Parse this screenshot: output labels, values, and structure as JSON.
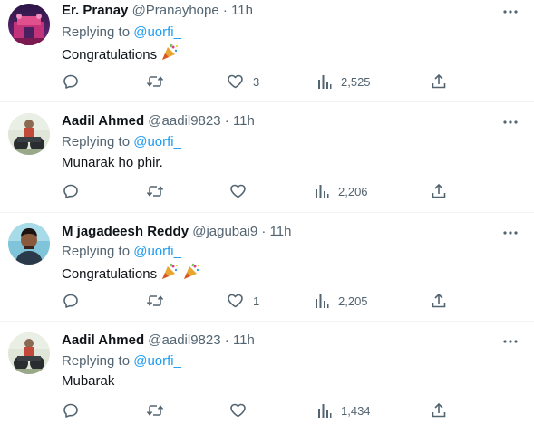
{
  "replying_prefix": "Replying to",
  "tweets": [
    {
      "name": "Er. Pranay",
      "handle": "@Pranayhope",
      "separator": "·",
      "time": "11h",
      "mention": "@uorfi_",
      "text": "Congratulations",
      "emoji": "party-popper-icon",
      "reply_count": "",
      "retweet_count": "",
      "like_count": "3",
      "view_count": "2,525"
    },
    {
      "name": "Aadil Ahmed",
      "handle": "@aadil9823",
      "separator": "·",
      "time": "11h",
      "mention": "@uorfi_",
      "text": "Munarak ho phir.",
      "reply_count": "",
      "retweet_count": "",
      "like_count": "",
      "view_count": "2,206"
    },
    {
      "name": "M jagadeesh Reddy",
      "handle": "@jagubai9",
      "separator": "·",
      "time": "11h",
      "mention": "@uorfi_",
      "text": "Congratulations",
      "emoji": "party-popper-icon",
      "reply_count": "",
      "retweet_count": "",
      "like_count": "1",
      "view_count": "2,205"
    },
    {
      "name": "Aadil Ahmed",
      "handle": "@aadil9823",
      "separator": "·",
      "time": "11h",
      "mention": "@uorfi_",
      "text": "Mubarak",
      "reply_count": "",
      "retweet_count": "",
      "like_count": "",
      "view_count": "1,434"
    }
  ],
  "colors": {
    "text_primary": "#0f1419",
    "text_secondary": "#536471",
    "mention": "#1d9bf0",
    "divider": "#eff3f4"
  }
}
